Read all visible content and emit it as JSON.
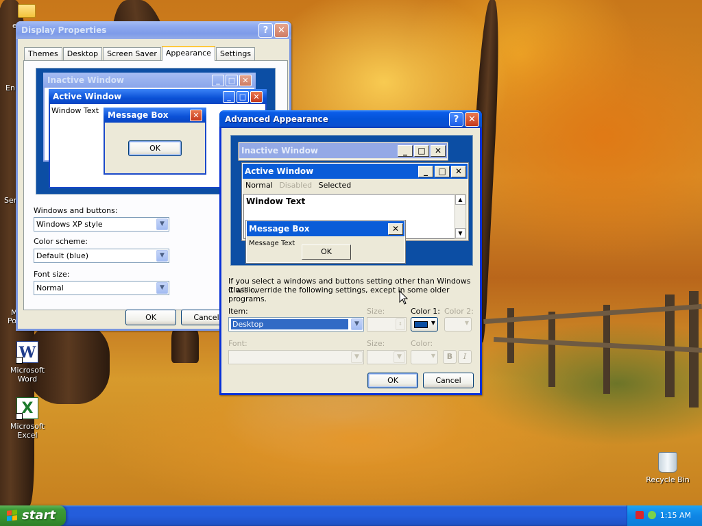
{
  "desktop": {
    "icons": {
      "word": "Microsoft Word",
      "excel": "Microsoft Excel",
      "recycle": "Recycle Bin"
    },
    "partial_labels": {
      "top": "En",
      "mid": "Ser",
      "lower_a": "M",
      "lower_b": "Po",
      "folder_short": "e"
    }
  },
  "display_properties": {
    "title": "Display Properties",
    "tabs": [
      "Themes",
      "Desktop",
      "Screen Saver",
      "Appearance",
      "Settings"
    ],
    "selected_tab": "Appearance",
    "preview": {
      "inactive_title": "Inactive Window",
      "active_title": "Active Window",
      "window_text": "Window Text",
      "message_title": "Message Box",
      "ok": "OK"
    },
    "windows_buttons_label": "Windows and buttons:",
    "windows_buttons_value": "Windows XP style",
    "color_scheme_label": "Color scheme:",
    "color_scheme_value": "Default (blue)",
    "font_size_label": "Font size:",
    "font_size_value": "Normal",
    "ok": "OK",
    "cancel": "Cancel"
  },
  "advanced": {
    "title": "Advanced Appearance",
    "preview": {
      "inactive_title": "Inactive Window",
      "active_title": "Active Window",
      "menu": [
        "Normal",
        "Disabled",
        "Selected"
      ],
      "window_text": "Window Text",
      "message_title": "Message Box",
      "message_text": "Message Text",
      "ok": "OK"
    },
    "info_line1": "If you select a windows and buttons setting other than Windows Classic,",
    "info_line2": "it will override the following settings, except in some older programs.",
    "item_label": "Item:",
    "item_value": "Desktop",
    "size_label": "Size:",
    "color1_label": "Color 1:",
    "color2_label": "Color 2:",
    "font_label": "Font:",
    "font_size_label": "Size:",
    "font_color_label": "Color:",
    "bold": "B",
    "italic": "I",
    "ok": "OK",
    "cancel": "Cancel"
  },
  "taskbar": {
    "start": "start",
    "time": "1:15 AM"
  },
  "colors": {
    "xp_blue": "#0831d9",
    "desktop_preview": "#0c4ea4",
    "color1_swatch": "#0b4ea2"
  }
}
